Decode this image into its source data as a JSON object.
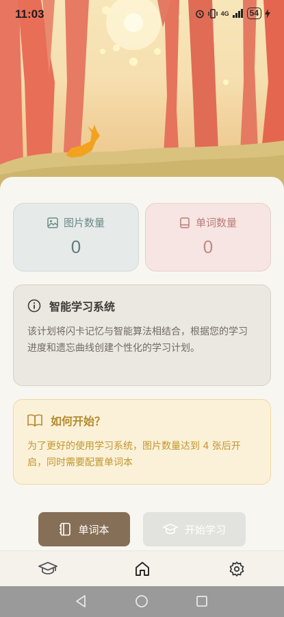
{
  "status_bar": {
    "time": "11:03",
    "network": "4G",
    "battery": "54"
  },
  "stats": {
    "images": {
      "label": "图片数量",
      "value": "0"
    },
    "words": {
      "label": "单词数量",
      "value": "0"
    }
  },
  "info_card": {
    "title": "智能学习系统",
    "body": "该计划将闪卡记忆与智能算法相结合，根据您的学习进度和遗忘曲线创建个性化的学习计划。"
  },
  "howto_card": {
    "title": "如何开始？",
    "body": "为了更好的使用学习系统，图片数量达到 4 张后开启，同时需要配置单词本"
  },
  "buttons": {
    "vocab": "单词本",
    "start": "开始学习"
  },
  "colors": {
    "accent_brown": "#866f57",
    "howto_gold": "#b38a2e",
    "image_teal": "#6c8983",
    "word_rose": "#b97c78"
  },
  "icons": {
    "nav": [
      "graduation-cap-icon",
      "home-icon",
      "settings-gear-icon"
    ],
    "system": [
      "back-icon",
      "home-circle-icon",
      "recents-icon"
    ]
  }
}
